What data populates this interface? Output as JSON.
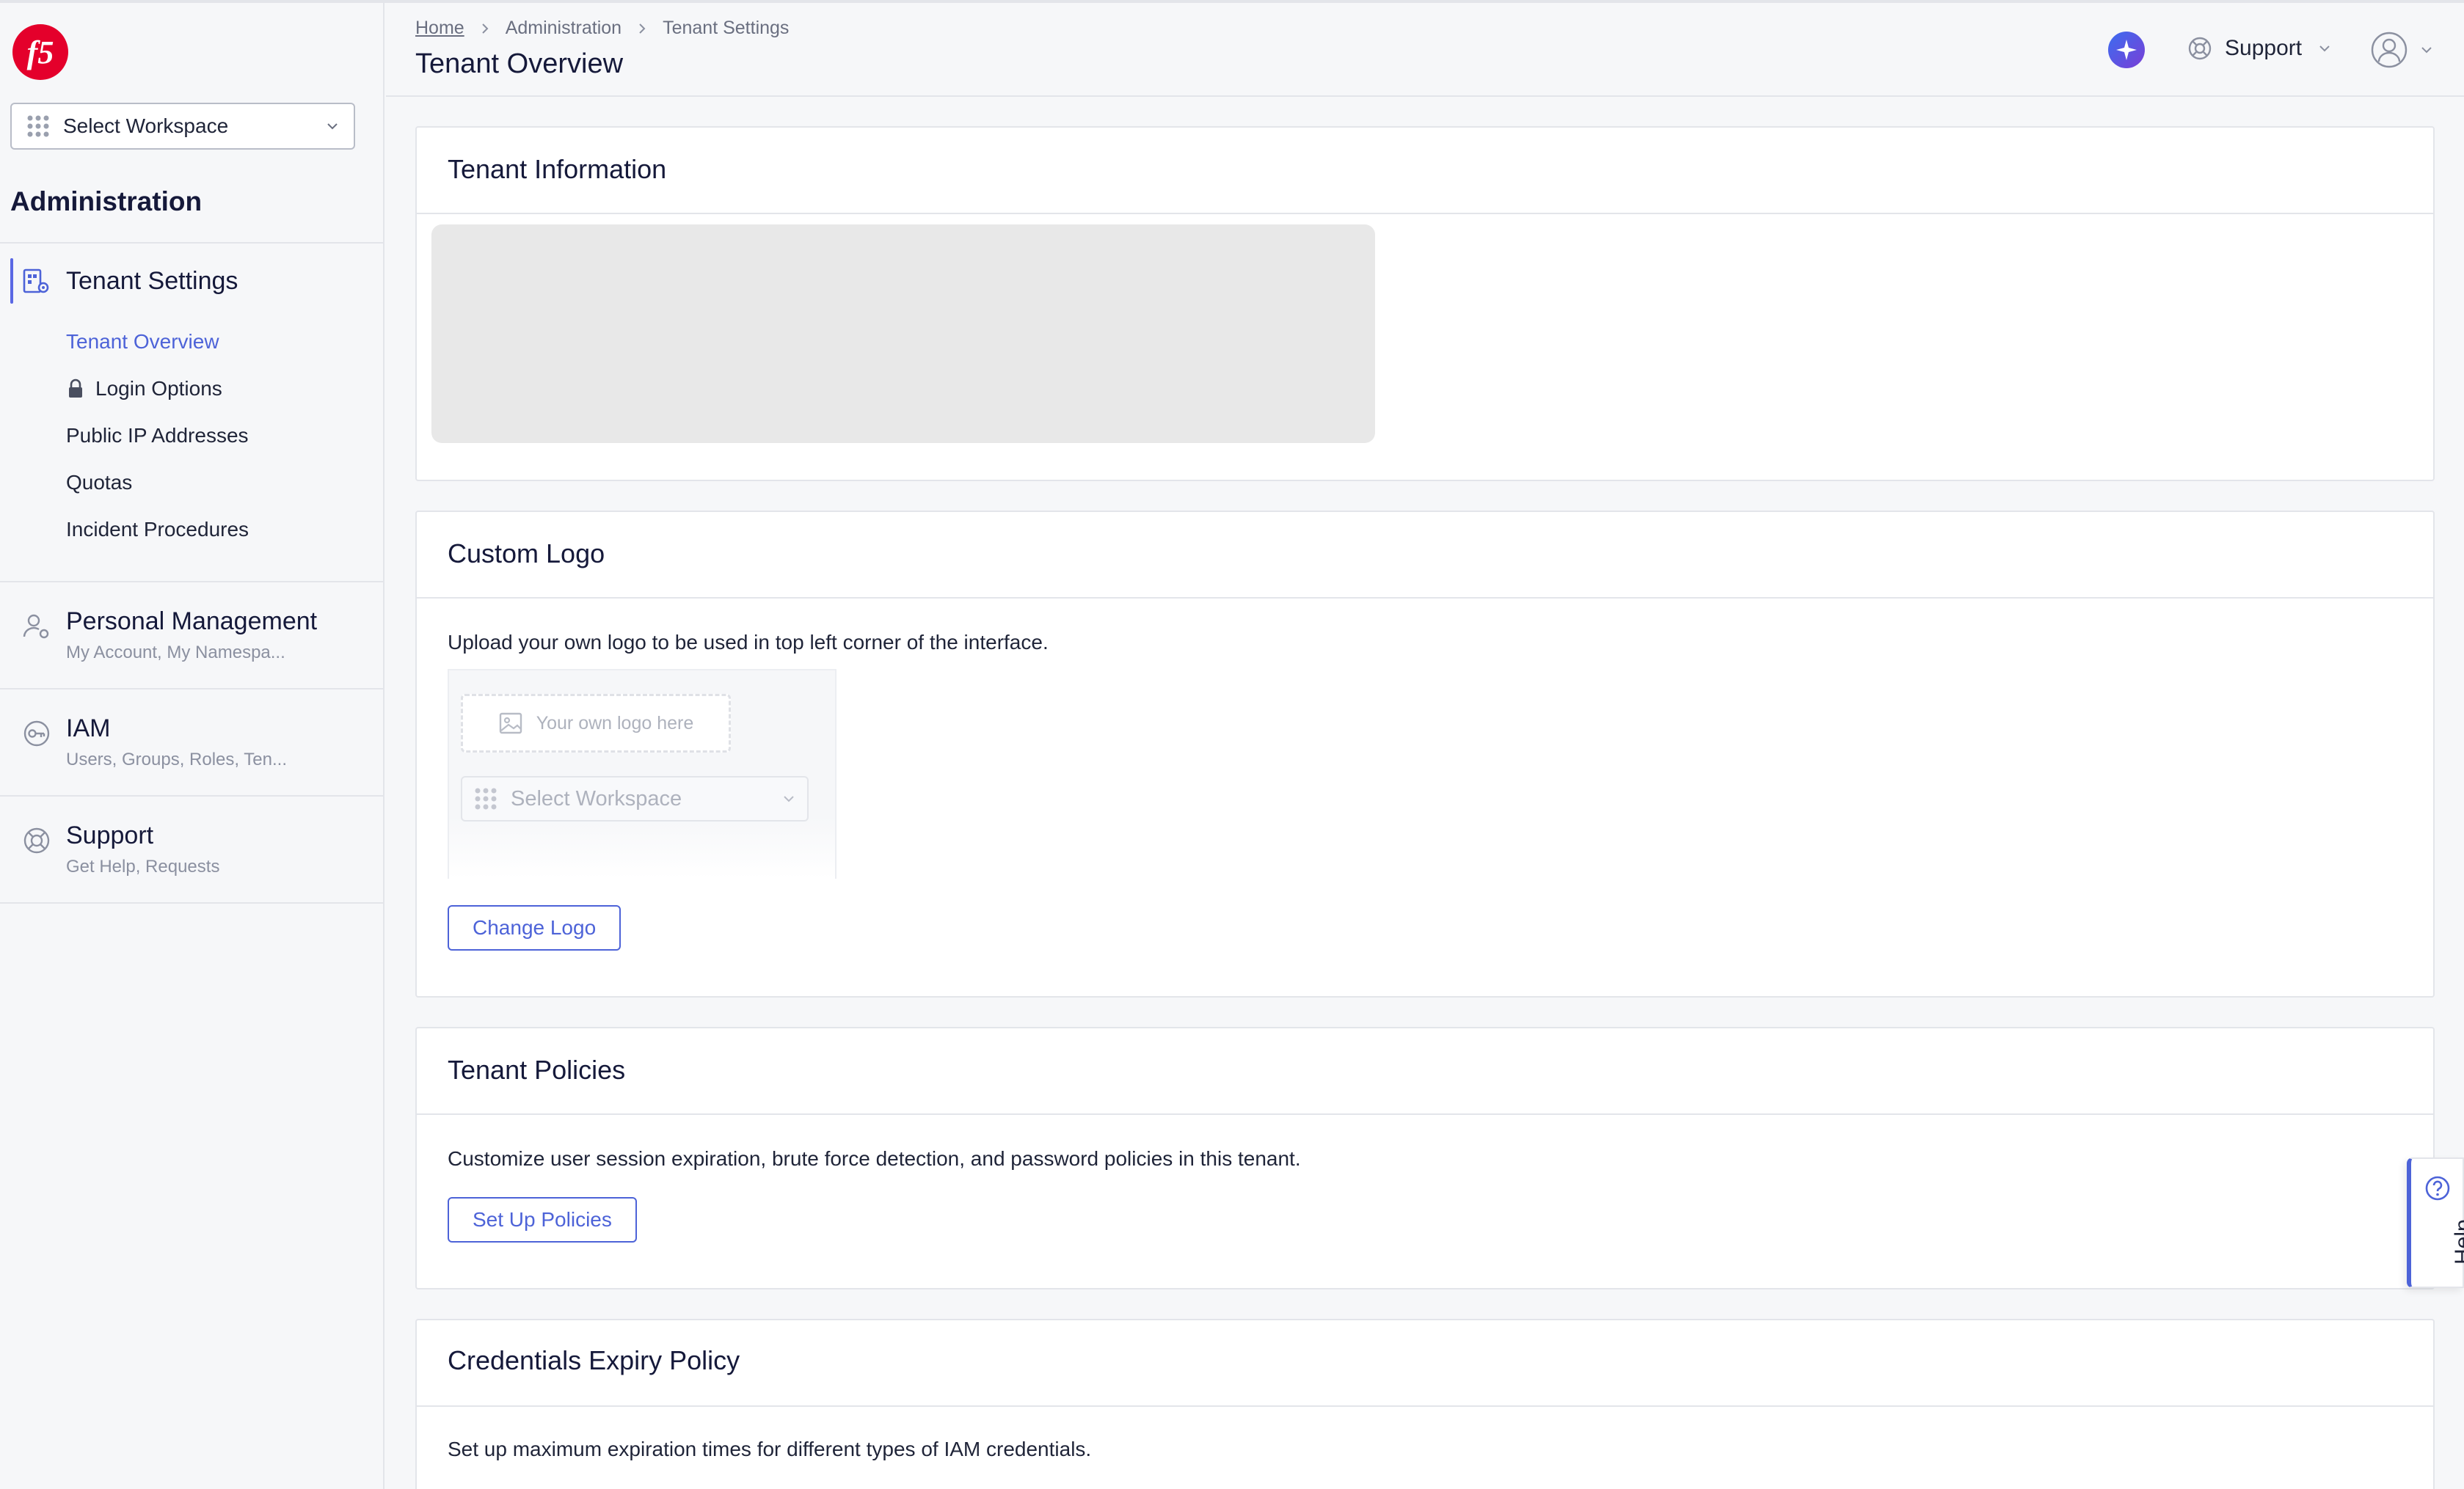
{
  "brand": {
    "logo_text": "f5",
    "accent_color": "#4d63d8",
    "logo_color": "#e4002b"
  },
  "sidebar": {
    "workspace_select": {
      "label": "Select Workspace",
      "icon": "grid-dots-icon"
    },
    "section_title": "Administration",
    "active_group": {
      "label": "Tenant Settings",
      "icon": "tenant-settings-icon",
      "items": [
        {
          "label": "Tenant Overview",
          "active": true
        },
        {
          "label": "Login Options",
          "icon": "lock-icon"
        },
        {
          "label": "Public IP Addresses"
        },
        {
          "label": "Quotas"
        },
        {
          "label": "Incident Procedures"
        }
      ]
    },
    "groups": [
      {
        "label": "Personal Management",
        "subtitle": "My Account, My Namespa...",
        "icon": "user-gear-icon"
      },
      {
        "label": "IAM",
        "subtitle": "Users, Groups, Roles, Ten...",
        "icon": "key-icon"
      },
      {
        "label": "Support",
        "subtitle": "Get Help, Requests",
        "icon": "lifebuoy-icon"
      }
    ]
  },
  "header": {
    "breadcrumbs": [
      "Home",
      "Administration",
      "Tenant Settings"
    ],
    "title": "Tenant Overview",
    "support_label": "Support"
  },
  "cards": {
    "tenant_information": {
      "title": "Tenant Information"
    },
    "custom_logo": {
      "title": "Custom Logo",
      "description": "Upload your own logo to be used in top left corner of the interface.",
      "preview_placeholder": "Your own logo here",
      "preview_workspace": "Select Workspace",
      "button": "Change Logo"
    },
    "tenant_policies": {
      "title": "Tenant Policies",
      "description": "Customize user session expiration, brute force detection, and password policies in this tenant.",
      "button": "Set Up Policies"
    },
    "credentials_expiry": {
      "title": "Credentials Expiry Policy",
      "description": "Set up maximum expiration times for different types of IAM credentials."
    }
  },
  "help_tab": {
    "label": "Help"
  }
}
